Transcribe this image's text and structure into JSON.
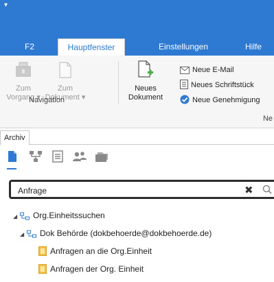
{
  "quick_access": {
    "arrow": "▾"
  },
  "tabs": [
    {
      "label": "F2"
    },
    {
      "label": "Hauptfenster",
      "active": true
    },
    {
      "label": "Einstellungen"
    },
    {
      "label": "Hilfe"
    }
  ],
  "ribbon": {
    "navigation": {
      "label": "Navigation",
      "zum_vorgang": {
        "line1": "Zum",
        "line2": "Vorgang ▾"
      },
      "zum_dokument": {
        "line1": "Zum",
        "line2": "Dokument ▾"
      }
    },
    "neues_dokument": {
      "line1": "Neues",
      "line2": "Dokument"
    },
    "small_items": [
      {
        "label": "Neue E-Mail",
        "icon": "envelope-icon"
      },
      {
        "label": "Neues Schriftstück",
        "icon": "document-lines-icon"
      },
      {
        "label": "Neue Genehmigung",
        "icon": "checkmark-badge-icon"
      }
    ],
    "group2_label": "Ne"
  },
  "archive_tab": {
    "label": "Archiv"
  },
  "view_icons": [
    "document-icon",
    "hierarchy-icon",
    "list-icon",
    "users-icon",
    "folder-stack-icon"
  ],
  "search": {
    "value": "Anfrage",
    "placeholder": ""
  },
  "tree": [
    {
      "label": "Org.Einheitssuchen",
      "level": 0,
      "icon": "org-unit-icon",
      "expanded": true
    },
    {
      "label": "Dok Behörde (dokbehoerde@dokbehoerde.de)",
      "level": 1,
      "icon": "org-unit-icon",
      "expanded": true
    },
    {
      "label": "Anfragen an die Org.Einheit",
      "level": 2,
      "icon": "saved-search-icon"
    },
    {
      "label": "Anfragen der Org. Einheit",
      "level": 2,
      "icon": "saved-search-icon"
    }
  ],
  "colors": {
    "accent": "#2e7ad2",
    "search_border": "#2b2b2b"
  }
}
